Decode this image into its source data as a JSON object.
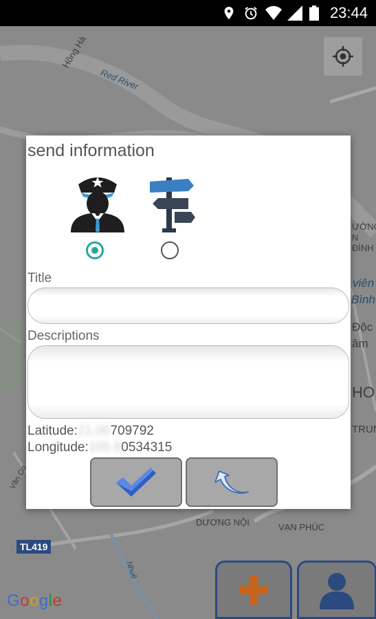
{
  "status_bar": {
    "time": "23:44",
    "icons": [
      "location-pin-icon",
      "alarm-clock-icon",
      "wifi-icon",
      "cell-signal-icon",
      "battery-icon"
    ]
  },
  "map": {
    "labels": [
      "Hồng Hà",
      "Red River",
      "ƯỜNG",
      "N ĐÌNH",
      "viên",
      "Bình",
      "Độc",
      "âm",
      "HO",
      "TRUN",
      "Vân Cơ",
      "DƯƠNG NỘI",
      "VẠN PHÚC",
      "Nhuệ"
    ],
    "road_badge": "TL419",
    "google_logo": [
      "G",
      "o",
      "o",
      "g",
      "l",
      "e"
    ],
    "colors": {
      "background": "#8a8a8a",
      "roads": "#a8a8a8",
      "badge": "#2b4a80"
    }
  },
  "dialog": {
    "title": "send information",
    "options": [
      {
        "icon": "police-officer-icon",
        "selected": true
      },
      {
        "icon": "signpost-icon",
        "selected": false
      }
    ],
    "title_label": "Title",
    "title_value": "",
    "descriptions_label": "Descriptions",
    "descriptions_value": "",
    "latitude_label": "Latitude:",
    "latitude_hidden": "21.00",
    "latitude_value": "709792",
    "longitude_label": "Longitude:",
    "longitude_hidden": "105.8",
    "longitude_value": "0534315",
    "confirm_icon": "checkmark-icon",
    "back_icon": "return-arrow-icon",
    "accent_color": "#26a69a"
  },
  "fabs": [
    {
      "icon": "plus-icon",
      "color": "#c6641c"
    },
    {
      "icon": "user-profile-icon",
      "color": "#2b4a80"
    }
  ]
}
